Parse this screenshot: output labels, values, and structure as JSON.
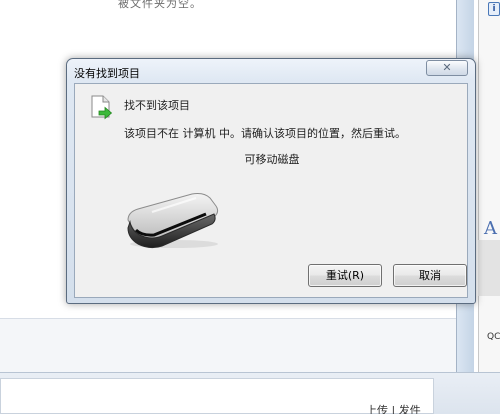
{
  "background": {
    "top_text": "被文件夹为空。",
    "bottom_text": "上传 | 发件",
    "side_letter": "A",
    "side_text": "QC"
  },
  "dialog": {
    "title": "没有找到项目",
    "close_label": "✕",
    "heading": "找不到该项目",
    "message": "该项目不在 计算机 中。请确认该项目的位置，然后重试。",
    "item_name": "可移动磁盘",
    "retry_label": "重试(R)",
    "cancel_label": "取消"
  },
  "icons": {
    "file": "document-arrow-icon",
    "drive": "removable-drive-icon",
    "close": "close-icon"
  },
  "colors": {
    "title_bar": "#dfe8f3",
    "body": "#f0f0f0",
    "arrow": "#3cb93a"
  }
}
